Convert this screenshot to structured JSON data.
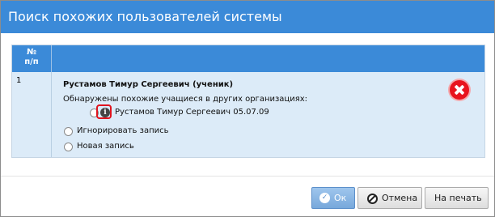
{
  "dialog": {
    "title": "Поиск похожих пользователей системы"
  },
  "table": {
    "header_num_line1": "№",
    "header_num_line2": "п/п",
    "row": {
      "num": "1",
      "person": "Рустамов Тимур Сергеевич (ученик)",
      "found_label": "Обнаружены похожие учащиеся в других организациях:",
      "match_option": "Рустамов Тимур Сергеевич 05.07.09",
      "ignore_option": "Игнорировать запись",
      "new_option": "Новая запись",
      "info_icon": "info-icon",
      "delete_icon": "delete-icon"
    }
  },
  "buttons": {
    "ok_label": "Ок",
    "cancel_label": "Отмена",
    "print_label": "На печать"
  },
  "colors": {
    "header": "#3b8ad8",
    "row_bg": "#dcebf8",
    "delete": "#e8141e",
    "highlight": "#e0141e"
  }
}
